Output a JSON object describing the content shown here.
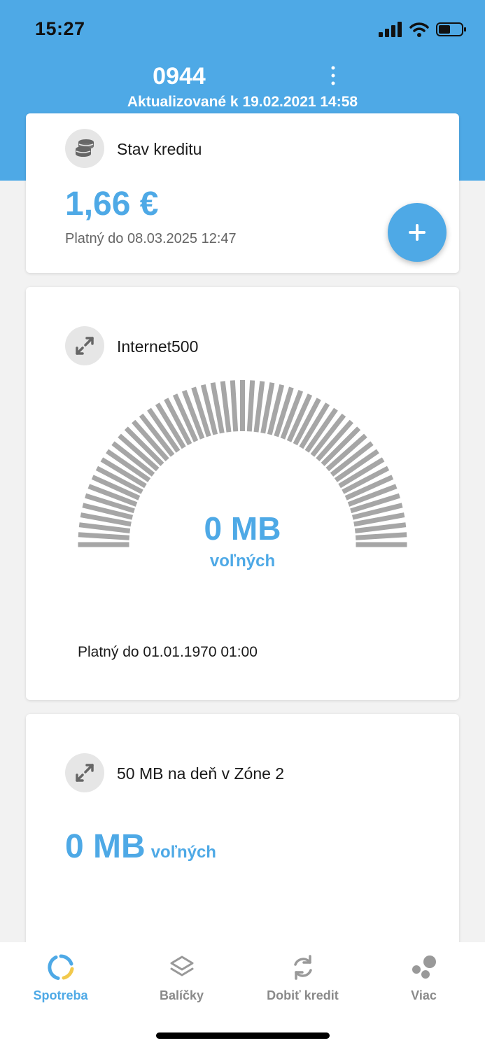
{
  "status_bar": {
    "time": "15:27"
  },
  "header": {
    "number": "0944",
    "updated": "Aktualizované k 19.02.2021 14:58",
    "menu_icon": "more-vertical-icon",
    "background_color": "#4ea9e6"
  },
  "credit_card": {
    "icon": "coins-icon",
    "title": "Stav kreditu",
    "amount": "1,66 €",
    "valid_until": "Platný do 08.03.2025 12:47",
    "add_button_icon": "plus-icon"
  },
  "internet_card": {
    "icon": "data-transfer-icon",
    "title": "Internet500",
    "remaining_value": "0 MB",
    "remaining_unit": "voľných",
    "remaining_fraction": 0,
    "valid_until": "Platný do 01.01.1970 01:00"
  },
  "zone_card": {
    "icon": "data-transfer-icon",
    "title": "50 MB na deň v Zóne 2",
    "remaining_value": "0 MB",
    "remaining_unit": "voľných"
  },
  "tabs": [
    {
      "label": "Spotreba",
      "icon": "usage-ring-icon",
      "active": true
    },
    {
      "label": "Balíčky",
      "icon": "layers-icon",
      "active": false
    },
    {
      "label": "Dobiť kredit",
      "icon": "refresh-icon",
      "active": false
    },
    {
      "label": "Viac",
      "icon": "more-dots-icon",
      "active": false
    }
  ],
  "colors": {
    "accent": "#4ea9e6",
    "gauge_tick": "#a6a6a6",
    "accent_yellow": "#f2c94c"
  }
}
